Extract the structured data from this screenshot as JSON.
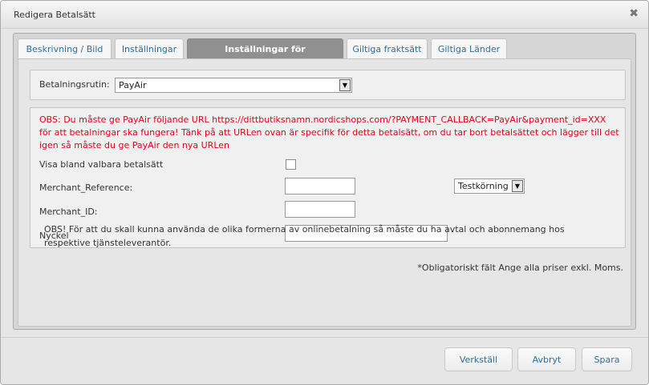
{
  "dialog": {
    "title": "Redigera Betalsätt",
    "close_symbol": "✖"
  },
  "tabs": [
    {
      "label": "Beskrivning / Bild",
      "active": false
    },
    {
      "label": "Inställningar",
      "active": false
    },
    {
      "label": "Inställningar för betalleverantör",
      "active": true
    },
    {
      "label": "Giltiga fraktsätt",
      "active": false
    },
    {
      "label": "Giltiga Länder",
      "active": false
    }
  ],
  "payment_routine": {
    "label": "Betalningsrutin:",
    "value": "PayAir"
  },
  "warning": "OBS: Du måste ge PayAir följande URL https://dittbutiksnamn.nordicshops.com/?PAYMENT_CALLBACK=PayAir&payment_id=XXX för att betalningar ska fungera! Tänk på att URLen ovan är specifik för detta betalsätt, om du tar bort betalsättet och lägger till det igen så måste du ge PayAir den nya URLen",
  "fields": {
    "show_selectable": {
      "label": "Visa bland valbara betalsätt",
      "checked": false
    },
    "merchant_reference": {
      "label": "Merchant_Reference:",
      "value": ""
    },
    "merchant_id": {
      "label": "Merchant_ID:",
      "value": ""
    },
    "key": {
      "label": "Nyckel",
      "value": ""
    }
  },
  "mode_select": {
    "value": "Testkörning"
  },
  "note": "OBS! För att du skall kunna använda de olika formerna av onlinebetalning så måste du ha avtal och abonnemang hos respektive tjänsteleverantör.",
  "required_note": "*Obligatoriskt fält Ange alla priser exkl. Moms.",
  "buttons": {
    "apply": "Verkställ",
    "cancel": "Avbryt",
    "save": "Spara"
  },
  "colors": {
    "warning": "#e8001c",
    "link": "#2e6e9e",
    "active_tab": "#909090"
  }
}
